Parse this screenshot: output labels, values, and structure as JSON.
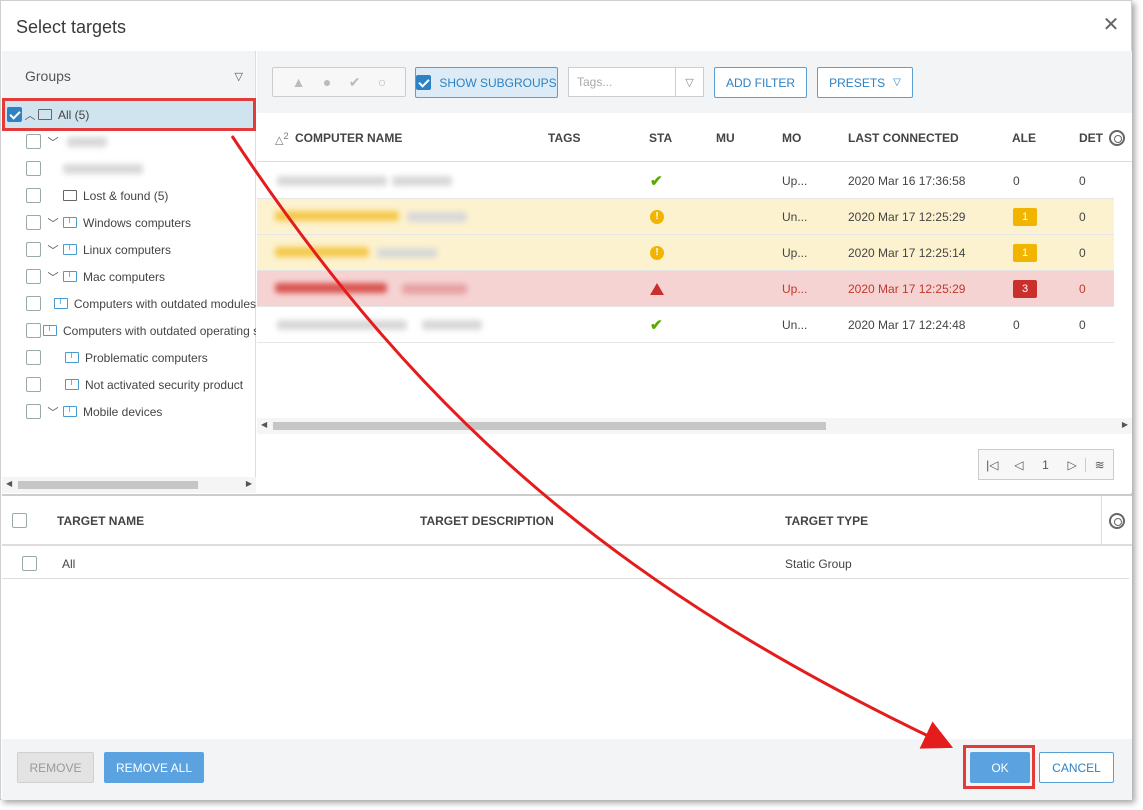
{
  "dialog": {
    "title": "Select targets",
    "close_label": "✕"
  },
  "groups": {
    "header": "Groups",
    "items": [
      {
        "label": "All (5)",
        "checked": true
      },
      {
        "label": "Lost & found (5)"
      },
      {
        "label": "Windows computers"
      },
      {
        "label": "Linux computers"
      },
      {
        "label": "Mac computers"
      },
      {
        "label": "Computers with outdated modules"
      },
      {
        "label": "Computers with outdated operating system"
      },
      {
        "label": "Problematic computers"
      },
      {
        "label": "Not activated security product"
      },
      {
        "label": "Mobile devices"
      }
    ]
  },
  "toolbar": {
    "show_subgroups": "SHOW SUBGROUPS",
    "tags_placeholder": "Tags...",
    "add_filter": "ADD FILTER",
    "presets": "PRESETS"
  },
  "grid": {
    "sort_indicator": "2",
    "columns": [
      "COMPUTER NAME",
      "TAGS",
      "STA",
      "MU",
      "MO",
      "LAST CONNECTED",
      "ALE",
      "DET"
    ],
    "rows": [
      {
        "status": "ok",
        "mo": "Up...",
        "last": "2020 Mar 16 17:36:58",
        "alerts": "0",
        "det": "0"
      },
      {
        "status": "warn",
        "mo": "Un...",
        "last": "2020 Mar 17 12:25:29",
        "alerts": "1",
        "det": "0"
      },
      {
        "status": "warn",
        "mo": "Up...",
        "last": "2020 Mar 17 12:25:14",
        "alerts": "1",
        "det": "0"
      },
      {
        "status": "crit",
        "mo": "Up...",
        "last": "2020 Mar 17 12:25:29",
        "alerts": "3",
        "det": "0"
      },
      {
        "status": "ok",
        "mo": "Un...",
        "last": "2020 Mar 17 12:24:48",
        "alerts": "0",
        "det": "0"
      }
    ],
    "page": "1"
  },
  "targets": {
    "columns": [
      "TARGET NAME",
      "TARGET DESCRIPTION",
      "TARGET TYPE"
    ],
    "rows": [
      {
        "name": "All",
        "description": "",
        "type": "Static Group"
      }
    ]
  },
  "footer": {
    "remove": "REMOVE",
    "remove_all": "REMOVE ALL",
    "ok": "OK",
    "cancel": "CANCEL"
  },
  "colors": {
    "accent": "#2e82c4",
    "warning": "#f1b400",
    "critical": "#c9302c",
    "ok": "#5aa900",
    "highlight": "#e33a3a"
  }
}
